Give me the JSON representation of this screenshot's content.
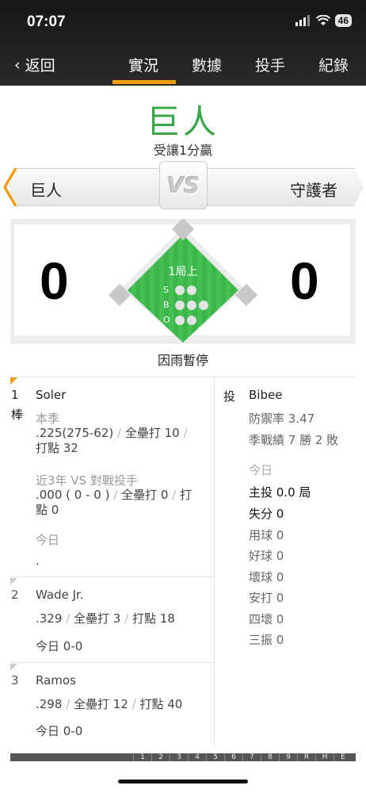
{
  "status_bar": {
    "time": "07:07",
    "battery": "46"
  },
  "nav": {
    "back_label": "返回",
    "tabs": [
      {
        "label": "實況",
        "active": true
      },
      {
        "label": "數據",
        "active": false
      },
      {
        "label": "投手",
        "active": false
      },
      {
        "label": "紀錄",
        "active": false
      }
    ]
  },
  "result": {
    "winner": "巨人",
    "subtitle": "受讓1分贏"
  },
  "teams": {
    "away": "巨人",
    "vs_label": "VS",
    "home": "守護者"
  },
  "scoreboard": {
    "away_score": "0",
    "home_score": "0",
    "inning": "1局上",
    "sbo": {
      "s_label": "S",
      "b_label": "B",
      "o_label": "O",
      "strikes": 0,
      "balls": 0,
      "outs": 0
    },
    "game_status": "因雨暫停"
  },
  "batters": [
    {
      "order": "1",
      "order_suffix": "棒",
      "name": "Soler",
      "season_label": "本季",
      "season_avg": ".225(275-62)",
      "season_hr": "全壘打 10",
      "season_rbi": "打點 32",
      "vs_label": "近3年 VS 對戰投手",
      "vs_avg": ".000 ( 0 - 0 )",
      "vs_hr": "全壘打 0",
      "vs_rbi": "打點 0",
      "today_label": "今日",
      "today_value": "."
    },
    {
      "order": "2",
      "name": "Wade Jr.",
      "avg": ".329",
      "hr": "全壘打 3",
      "rbi": "打點 18",
      "today": "今日 0-0"
    },
    {
      "order": "3",
      "name": "Ramos",
      "avg": ".298",
      "hr": "全壘打 12",
      "rbi": "打點 40",
      "today": "今日 0-0"
    }
  ],
  "pitcher": {
    "label": "投",
    "name": "Bibee",
    "era": "防禦率 3.47",
    "record": "季戰績 7 勝 2 敗",
    "today_label": "今日",
    "innings": "主投 0.0 局",
    "runs": "失分 0",
    "pitches": "用球 0",
    "strikes": "好球 0",
    "balls": "壞球 0",
    "hits": "安打 0",
    "walks": "四壞 0",
    "strikeouts": "三振 0"
  },
  "linescore_header": [
    "1",
    "2",
    "3",
    "4",
    "5",
    "6",
    "7",
    "8",
    "9",
    "R",
    "H",
    "E"
  ],
  "colors": {
    "accent": "#f39c12",
    "field_green": "#3cb54a",
    "winner_green": "#3aa64a"
  }
}
